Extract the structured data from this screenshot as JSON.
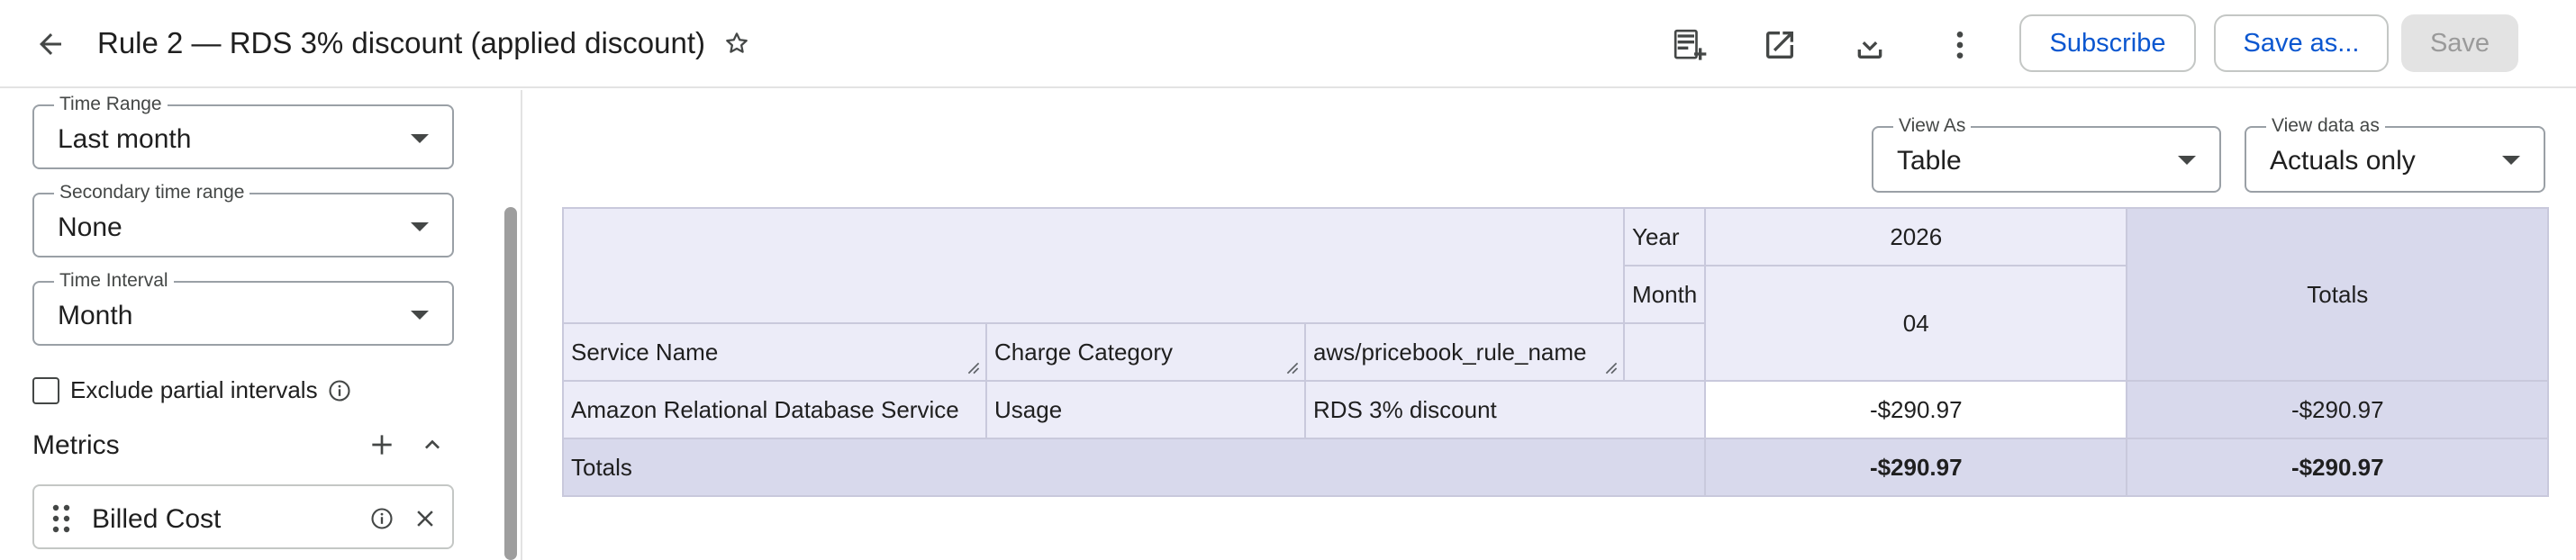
{
  "header": {
    "title": "Rule 2 — RDS 3% discount (applied discount)",
    "subscribe_label": "Subscribe",
    "save_as_label": "Save as...",
    "save_label": "Save"
  },
  "sidebar": {
    "time_range": {
      "label": "Time Range",
      "value": "Last month"
    },
    "secondary_time_range": {
      "label": "Secondary time range",
      "value": "None"
    },
    "time_interval": {
      "label": "Time Interval",
      "value": "Month"
    },
    "exclude_partial": {
      "label": "Exclude partial intervals",
      "checked": false
    },
    "metrics": {
      "title": "Metrics",
      "items": [
        "Billed Cost"
      ]
    }
  },
  "view": {
    "view_as": {
      "label": "View As",
      "value": "Table"
    },
    "view_data_as": {
      "label": "View data as",
      "value": "Actuals only"
    }
  },
  "table": {
    "year_label": "Year",
    "year_value": "2026",
    "month_label": "Month",
    "month_value": "04",
    "totals_header": "Totals",
    "columns": [
      "Service Name",
      "Charge Category",
      "aws/pricebook_rule_name"
    ],
    "rows": [
      {
        "service": "Amazon Relational Database Service",
        "category": "Usage",
        "rule": "RDS 3% discount",
        "value": "-$290.97",
        "total": "-$290.97"
      }
    ],
    "totals_row": {
      "label": "Totals",
      "value": "-$290.97",
      "total": "-$290.97"
    }
  },
  "colors": {
    "accent": "#0b57d0",
    "table_header": "#ececf8",
    "totals": "#d8d9ec"
  }
}
